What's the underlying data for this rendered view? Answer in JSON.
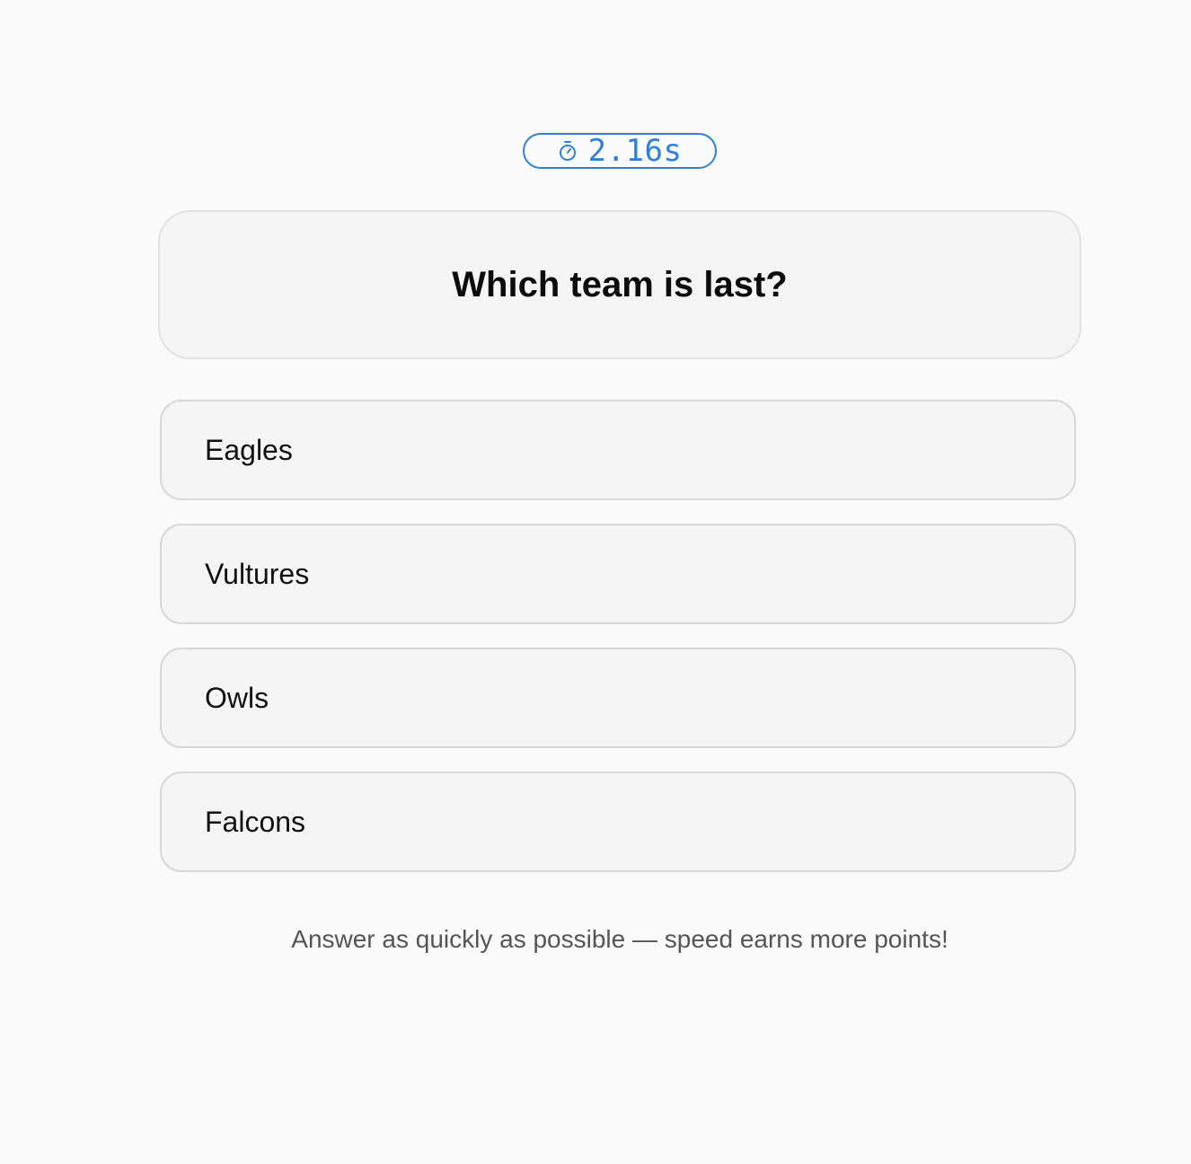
{
  "timer": {
    "icon": "stopwatch-icon",
    "value": "2.16s",
    "accent_color": "#2f80d8"
  },
  "question": {
    "text": "Which team is last?"
  },
  "options": [
    {
      "label": "Eagles"
    },
    {
      "label": "Vultures"
    },
    {
      "label": "Owls"
    },
    {
      "label": "Falcons"
    }
  ],
  "footer": {
    "hint": "Answer as quickly as possible — speed earns more points!"
  }
}
